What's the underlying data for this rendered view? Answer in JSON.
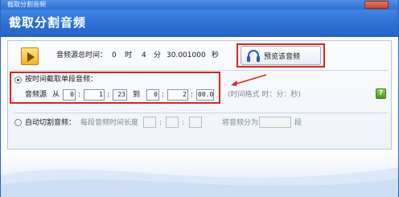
{
  "window": {
    "title": "截取分割音频",
    "header_title": "截取分割音频"
  },
  "file_info": {
    "total_label": "音频源总时间：",
    "hours": "0",
    "hour_unit": "时",
    "minutes": "4",
    "minute_unit": "分",
    "seconds": "30.001000",
    "second_unit": "秒"
  },
  "preview_button": {
    "label": "预览该音频"
  },
  "by_time": {
    "title": "按时间截取单段音频：",
    "source_label": "音频源",
    "from_label": "从",
    "to_label": "到",
    "start": [
      "0",
      "1",
      "23"
    ],
    "end": [
      "0",
      "2",
      "00.0"
    ],
    "format_hint": "(时间格式 时：分：秒)"
  },
  "auto_split": {
    "title": "自动切割音频：",
    "segment_label": "每段音频时间长度",
    "split_label": "将音频分为",
    "segment_unit": "段",
    "segment_values": [
      "",
      "",
      ""
    ],
    "count_value": ""
  },
  "help": {
    "glyph": "?"
  },
  "colors": {
    "highlight_red": "#e02020",
    "header_blue": "#2c6fd3"
  }
}
